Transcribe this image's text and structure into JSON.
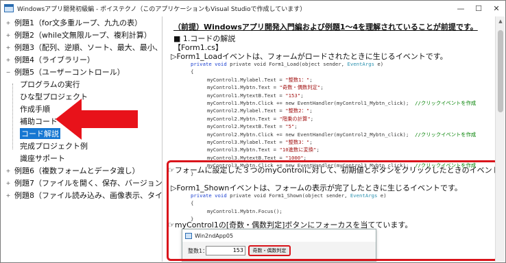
{
  "window": {
    "title": "Windowsアプリ開発初級編 - ポイステクノ（このアプリケーションもVisual Studioで作成しています）",
    "controls": [
      "—",
      "☐",
      "✕"
    ]
  },
  "tree": {
    "items": [
      {
        "label": "例題1（for文多重ループ、九九の表）",
        "expander": "+"
      },
      {
        "label": "例題2（while文無限ループ、複利計算）",
        "expander": "+"
      },
      {
        "label": "例題3（配列、逆順、ソート、最大、最小、平均）",
        "expander": "+"
      },
      {
        "label": "例題4（ライブラリー）",
        "expander": "+"
      },
      {
        "label": "例題5（ユーザーコントロール）",
        "expander": "−"
      },
      {
        "label": "プログラムの実行",
        "expander": ""
      },
      {
        "label": "ひな型プロジェクト",
        "expander": ""
      },
      {
        "label": "作成手順",
        "expander": ""
      },
      {
        "label": "補助コード",
        "expander": ""
      },
      {
        "label": "コード解説",
        "expander": "",
        "selected": true
      },
      {
        "label": "完成プロジェクト例",
        "expander": ""
      },
      {
        "label": "識座サポート",
        "expander": ""
      },
      {
        "label": "例題6（複数フォームとデータ渡し）",
        "expander": "+"
      },
      {
        "label": "例題7（ファイルを開く、保存、バージョン情報）",
        "expander": "+"
      },
      {
        "label": "例題8（ファイル読み込み、画像表示、タイマー）",
        "expander": "+"
      }
    ]
  },
  "doc": {
    "title": "（前提）Windowsアプリ開発入門編および例題1～4を理解されていることが前提です。",
    "section": "■ 1.コードの解説",
    "file": "【Form1.cs】",
    "load_desc": "▷Form1_Loadイベントは、フォームがロードされたときに生じるイベントです。",
    "note1": "☞フォームに設定した３つのmyControlに対して、初期値とボタンをクリックしたときのイベントを設定しています。",
    "shown_desc": "▷Form1_Shownイベントは、フォームの表示が完了したときに生じるイベントです。",
    "note2": "☞myControl1の[奇数・偶数判定]ボタンにフォーカスを当てています。"
  },
  "code1": {
    "sig_a": "private void Form1_Load(object sender, ",
    "sig_type": "EventArgs",
    "sig_b": " e)",
    "open": "{",
    "lines": [
      {
        "pre": "myControl1.Mylabel.Text = ",
        "str": "\"整数1：\"",
        "post": ";",
        "cm": ""
      },
      {
        "pre": "myControl1.Mybtn.Text = ",
        "str": "\"奇数・偶数判定\"",
        "post": ";",
        "cm": ""
      },
      {
        "pre": "myControl1.MytextB.Text = ",
        "str": "\"153\"",
        "post": ";",
        "cm": ""
      },
      {
        "pre": "myControl1.Mybtn.Click += new EventHandler(myControl1_Mybtn_click);",
        "str": "",
        "post": "",
        "cm": "//クリックイベントを作成"
      },
      {
        "pre": "myControl2.Mylabel.Text = ",
        "str": "\"整数2：\"",
        "post": ";",
        "cm": ""
      },
      {
        "pre": "myControl2.Mybtn.Text = ",
        "str": "\"階乗の計算\"",
        "post": ";",
        "cm": ""
      },
      {
        "pre": "myControl2.MytextB.Text = ",
        "str": "\"5\"",
        "post": ";",
        "cm": ""
      },
      {
        "pre": "myControl2.Mybtn.Click += new EventHandler(myControl2_Mybtn_click);",
        "str": "",
        "post": "",
        "cm": "//クリックイベントを作成"
      },
      {
        "pre": "myControl3.Mylabel.Text = ",
        "str": "\"整数3：\"",
        "post": ";",
        "cm": ""
      },
      {
        "pre": "myControl3.Mybtn.Text = ",
        "str": "\"10進数に変換\"",
        "post": ";",
        "cm": ""
      },
      {
        "pre": "myControl3.MytextB.Text = ",
        "str": "\"1000\"",
        "post": ";",
        "cm": ""
      },
      {
        "pre": "myControl3.Mybtn.Click += new EventHandler(myControl3_Mybtn_click);",
        "str": "",
        "post": "",
        "cm": "//クリックイベントを作成"
      }
    ],
    "close": "}"
  },
  "code2": {
    "sig_a": "private void Form1_Shown(object sender, ",
    "sig_type": "EventArgs",
    "sig_b": " e)",
    "open": "{",
    "body": "myControl1.Mybtn.Focus();",
    "close": "}"
  },
  "mini": {
    "title": "Win2ndApp05",
    "label": "整数1：",
    "value": "153",
    "button": "奇数・偶数判定"
  },
  "colors": {
    "accent": "#d9141b",
    "selection": "#1677d2"
  }
}
